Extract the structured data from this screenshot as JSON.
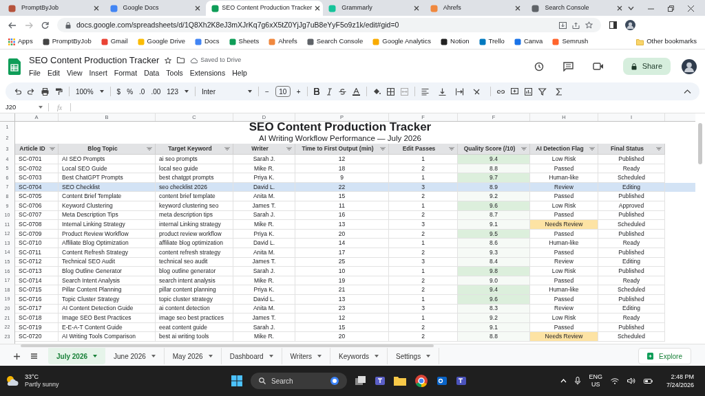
{
  "browser": {
    "tabs": [
      {
        "title": "PromptByJob",
        "selected": false
      },
      {
        "title": "Google Docs",
        "selected": false
      },
      {
        "title": "SEO Content Production Tracker",
        "selected": true
      },
      {
        "title": "Grammarly",
        "selected": false
      },
      {
        "title": "Ahrefs",
        "selected": false
      },
      {
        "title": "Search Console",
        "selected": false
      }
    ],
    "url": "docs.google.com/spreadsheets/d/1Q8Xh2K8eJ3mXJrKq7g6xX5tZ0YjJg7uB8eYyF5o9z1k/edit#gid=0",
    "bookmarks": [
      "Apps",
      "PromptByJob",
      "Gmail",
      "Google Drive",
      "Docs",
      "Sheets",
      "Ahrefs",
      "Search Console",
      "Google Analytics",
      "Notion",
      "Trello",
      "Canva",
      "Semrush"
    ],
    "other_bookmarks": "Other bookmarks"
  },
  "doc": {
    "title": "SEO Content Production Tracker",
    "save_status": "Saved to Drive",
    "menu": [
      "File",
      "Edit",
      "View",
      "Insert",
      "Format",
      "Data",
      "Tools",
      "Extensions",
      "Help"
    ],
    "share": "Share"
  },
  "toolbar": {
    "zoom": "100%",
    "currency": "$",
    "percent": "%",
    "decrease_decimals": ".0",
    "increase_decimals": ".00",
    "number_format": "123",
    "font": "Inter",
    "font_size": "10",
    "minus": "−",
    "plus": "+"
  },
  "formula_bar": {
    "cell_ref": "J20",
    "fx": "fx"
  },
  "sheet": {
    "column_letters": [
      "A",
      "B",
      "C",
      "D",
      "P",
      "F",
      "F",
      "H",
      "I"
    ],
    "row_numbers": [
      "1",
      "2",
      "3",
      "4",
      "5",
      "6",
      "7",
      "8",
      "9",
      "10",
      "11",
      "12",
      "13",
      "14",
      "15",
      "16",
      "17",
      "18",
      "19",
      "20",
      "21",
      "22",
      "23"
    ],
    "title": "SEO Content Production Tracker",
    "subtitle": "AI Writing Workflow Performance — July 2026",
    "headers": [
      "Article ID",
      "Blog Topic",
      "Target Keyword",
      "Writer",
      "Time to First Output (min)",
      "Edit Passes",
      "Quality Score (/10)",
      "AI Detection Flag",
      "Final Status"
    ],
    "rows": [
      {
        "cells": [
          "SC-0701",
          "AI SEO Prompts",
          "ai seo prompts",
          "Sarah J.",
          "12",
          "1",
          "9.4",
          "Low Risk",
          "Published"
        ],
        "selected": false,
        "score_high": true,
        "flag_alert": false
      },
      {
        "cells": [
          "SC-0702",
          "Local SEO Guide",
          "local seo guide",
          "Mike R.",
          "18",
          "2",
          "8.8",
          "Passed",
          "Ready"
        ],
        "selected": false,
        "score_high": false,
        "flag_alert": false
      },
      {
        "cells": [
          "SC-0703",
          "Best ChatGPT Prompts",
          "best chatgpt prompts",
          "Priya K.",
          "9",
          "1",
          "9.7",
          "Human-like",
          "Scheduled"
        ],
        "selected": false,
        "score_high": true,
        "flag_alert": false
      },
      {
        "cells": [
          "SC-0704",
          "SEO Checklist",
          "seo checklist 2026",
          "David L.",
          "22",
          "3",
          "8.9",
          "Review",
          "Editing"
        ],
        "selected": true,
        "score_high": false,
        "flag_alert": false
      },
      {
        "cells": [
          "SC-0705",
          "Content Brief Template",
          "content brief template",
          "Anita M.",
          "15",
          "2",
          "9.2",
          "Passed",
          "Published"
        ],
        "selected": false,
        "score_high": false,
        "flag_alert": false
      },
      {
        "cells": [
          "SC-0706",
          "Keyword Clustering",
          "keyword clustering seo",
          "James T.",
          "11",
          "1",
          "9.6",
          "Low Risk",
          "Approved"
        ],
        "selected": false,
        "score_high": true,
        "flag_alert": false
      },
      {
        "cells": [
          "SC-0707",
          "Meta Description Tips",
          "meta description tips",
          "Sarah J.",
          "16",
          "2",
          "8.7",
          "Passed",
          "Published"
        ],
        "selected": false,
        "score_high": false,
        "flag_alert": false
      },
      {
        "cells": [
          "SC-0708",
          "Internal Linking Strategy",
          "internal Linking strategy",
          "Mike R.",
          "13",
          "3",
          "9.1",
          "Needs Review",
          "Scheduled"
        ],
        "selected": false,
        "score_high": false,
        "flag_alert": true
      },
      {
        "cells": [
          "SC-0709",
          "Product Review Workflow",
          "product review workflow",
          "Priya K.",
          "20",
          "2",
          "9.5",
          "Passed",
          "Published"
        ],
        "selected": false,
        "score_high": true,
        "flag_alert": false
      },
      {
        "cells": [
          "SC-0710",
          "Affiliate Blog Optimization",
          "affiliate blog optimization",
          "David L.",
          "14",
          "1",
          "8.6",
          "Human-like",
          "Ready"
        ],
        "selected": false,
        "score_high": false,
        "flag_alert": false
      },
      {
        "cells": [
          "SC-0711",
          "Content Refresh Strategy",
          "content refresh strategy",
          "Anita M.",
          "17",
          "2",
          "9.3",
          "Passed",
          "Published"
        ],
        "selected": false,
        "score_high": false,
        "flag_alert": false
      },
      {
        "cells": [
          "SC-0712",
          "Technical SEO Audit",
          "technical seo audit",
          "James T.",
          "25",
          "3",
          "8.4",
          "Review",
          "Editing"
        ],
        "selected": false,
        "score_high": false,
        "flag_alert": false
      },
      {
        "cells": [
          "SC-0713",
          "Blog Outline Generator",
          "blog outline generator",
          "Sarah J.",
          "10",
          "1",
          "9.8",
          "Low Risk",
          "Published"
        ],
        "selected": false,
        "score_high": true,
        "flag_alert": false
      },
      {
        "cells": [
          "SC-0714",
          "Search Intent Analysis",
          "search intent analysis",
          "Mike R.",
          "19",
          "2",
          "9.0",
          "Passed",
          "Ready"
        ],
        "selected": false,
        "score_high": false,
        "flag_alert": false
      },
      {
        "cells": [
          "SC-0715",
          "Pillar Content Planning",
          "pillar content planning",
          "Priya K.",
          "21",
          "2",
          "9.4",
          "Human-like",
          "Scheduled"
        ],
        "selected": false,
        "score_high": true,
        "flag_alert": false
      },
      {
        "cells": [
          "SC-0716",
          "Topic Cluster Strategy",
          "topic cluster strategy",
          "David L.",
          "13",
          "1",
          "9.6",
          "Passed",
          "Published"
        ],
        "selected": false,
        "score_high": true,
        "flag_alert": false
      },
      {
        "cells": [
          "SC-0717",
          "AI Content Detection Guide",
          "ai content detection",
          "Anita M.",
          "23",
          "3",
          "8.3",
          "Review",
          "Editing"
        ],
        "selected": false,
        "score_high": false,
        "flag_alert": false
      },
      {
        "cells": [
          "SC-0718",
          "Image SEO Best Practices",
          "image seo best practices",
          "James T.",
          "12",
          "1",
          "9.2",
          "Low Risk",
          "Ready"
        ],
        "selected": false,
        "score_high": false,
        "flag_alert": false
      },
      {
        "cells": [
          "SC-0719",
          "E-E-A-T Content Guide",
          "eeat content guide",
          "Sarah J.",
          "15",
          "2",
          "9.1",
          "Passed",
          "Published"
        ],
        "selected": false,
        "score_high": false,
        "flag_alert": false
      },
      {
        "cells": [
          "SC-0720",
          "AI Writing Tools Comparison",
          "best ai writing tools",
          "Mike R.",
          "20",
          "2",
          "8.8",
          "Needs Review",
          "Scheduled"
        ],
        "selected": false,
        "score_high": false,
        "flag_alert": true
      }
    ]
  },
  "sheet_tabs": [
    {
      "label": "July 2026",
      "selected": true
    },
    {
      "label": "June 2026",
      "selected": false
    },
    {
      "label": "May 2026",
      "selected": false
    },
    {
      "label": "Dashboard",
      "selected": false
    },
    {
      "label": "Writers",
      "selected": false
    },
    {
      "label": "Keywords",
      "selected": false
    },
    {
      "label": "Settings",
      "selected": false
    }
  ],
  "explore": "Explore",
  "taskbar": {
    "temperature": "33°C",
    "weather": "Partly sunny",
    "search": "Search",
    "language": "ENG",
    "region": "US",
    "time": "2:48 PM",
    "date": "7/24/2026"
  }
}
